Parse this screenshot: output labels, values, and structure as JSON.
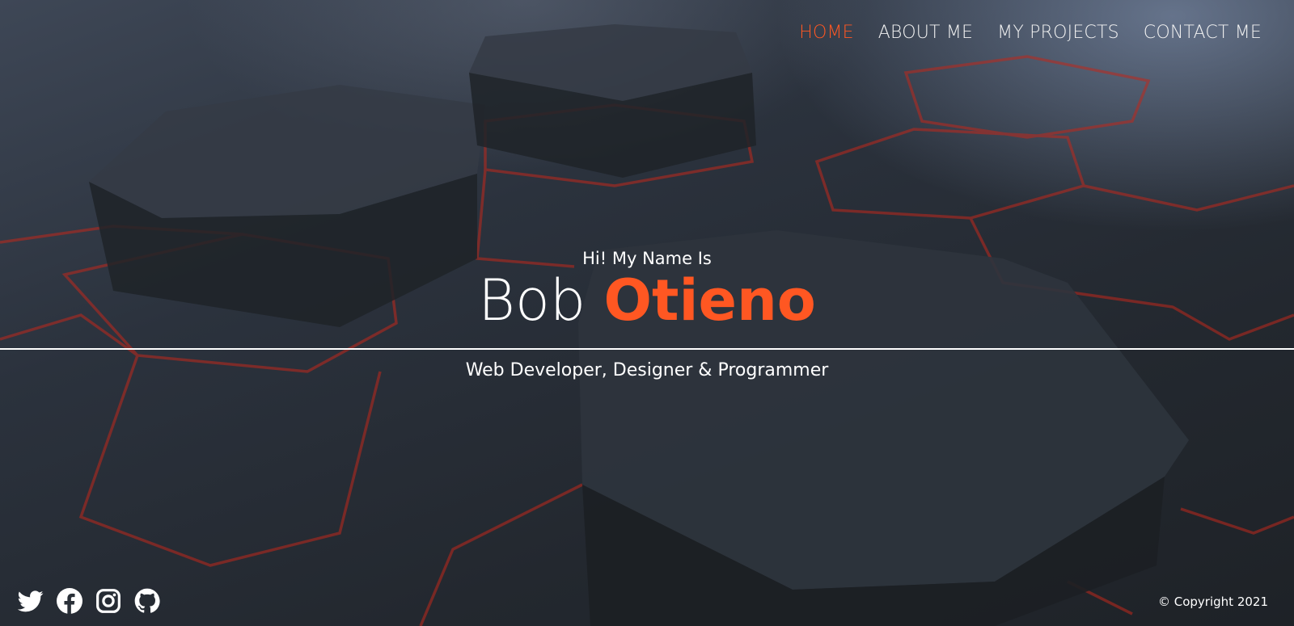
{
  "nav": {
    "items": [
      {
        "label": "HOME",
        "active": true
      },
      {
        "label": "ABOUT ME",
        "active": false
      },
      {
        "label": "MY PROJECTS",
        "active": false
      },
      {
        "label": "CONTACT ME",
        "active": false
      }
    ]
  },
  "hero": {
    "greeting": "Hi! My Name Is",
    "first_name": "Bob",
    "last_name": "Otieno",
    "tagline": "Web Developer, Designer & Programmer"
  },
  "social": {
    "icons": [
      "twitter-icon",
      "facebook-icon",
      "instagram-icon",
      "github-icon"
    ]
  },
  "footer": {
    "copyright": "© Copyright 2021"
  },
  "colors": {
    "accent": "#ff5722",
    "text": "#ffffff",
    "background": "#2b323d",
    "grid_lines": "#c0281c"
  }
}
